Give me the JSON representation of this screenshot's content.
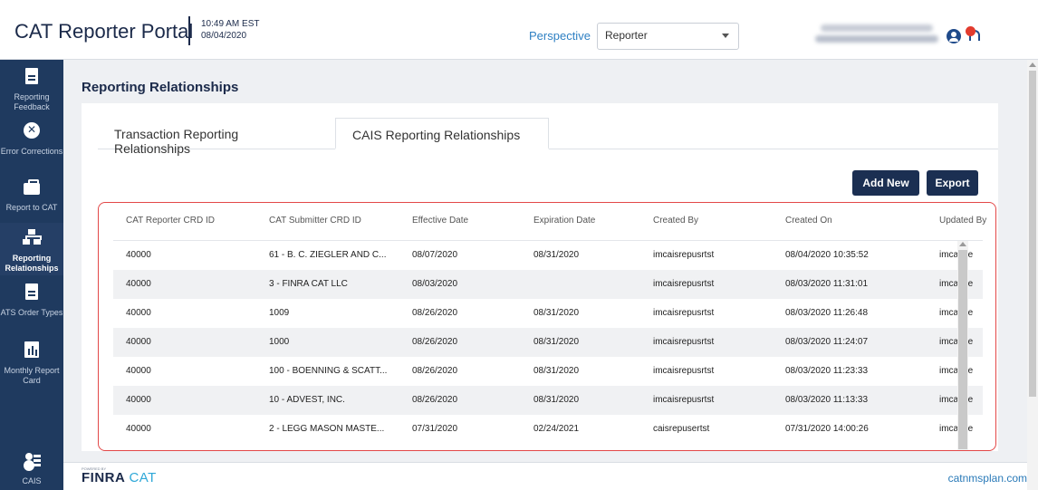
{
  "header": {
    "brand_cat": "CAT",
    "brand_rest": " Reporter Portal",
    "time": "10:49 AM EST",
    "date": "08/04/2020",
    "perspective_label": "Perspective",
    "perspective_value": "Reporter",
    "user_icon": "user-circle-icon",
    "bell_icon": "bell-icon"
  },
  "sidebar": {
    "items": [
      {
        "label": "Reporting Feedback",
        "icon": "document-icon"
      },
      {
        "label": "Error Corrections",
        "icon": "x-circle-icon"
      },
      {
        "label": "Report to CAT",
        "icon": "briefcase-icon"
      },
      {
        "label": "Reporting Relationships",
        "icon": "sitemap-icon"
      },
      {
        "label": "ATS Order Types",
        "icon": "document-icon"
      },
      {
        "label": "Monthly Report Card",
        "icon": "chart-icon"
      },
      {
        "label": "CAIS",
        "icon": "users-icon"
      }
    ]
  },
  "main": {
    "title": "Reporting Relationships",
    "tabs": [
      {
        "label": "Transaction Reporting Relationships"
      },
      {
        "label": "CAIS Reporting Relationships"
      }
    ],
    "buttons": {
      "add": "Add New",
      "export": "Export"
    }
  },
  "table": {
    "columns": [
      "CAT Reporter CRD ID",
      "CAT Submitter CRD ID",
      "Effective Date",
      "Expiration Date",
      "Created By",
      "Created On",
      "Updated By"
    ],
    "rows": [
      [
        "40000",
        "61 - B. C. ZIEGLER AND C...",
        "08/07/2020",
        "08/31/2020",
        "imcaisrepusrtst",
        "08/04/2020 10:35:52",
        "imcaisre"
      ],
      [
        "40000",
        "3 - FINRA CAT LLC",
        "08/03/2020",
        "",
        "imcaisrepusrtst",
        "08/03/2020 11:31:01",
        "imcaisre"
      ],
      [
        "40000",
        "1009",
        "08/26/2020",
        "08/31/2020",
        "imcaisrepusrtst",
        "08/03/2020 11:26:48",
        "imcaisre"
      ],
      [
        "40000",
        "1000",
        "08/26/2020",
        "08/31/2020",
        "imcaisrepusrtst",
        "08/03/2020 11:24:07",
        "imcaisre"
      ],
      [
        "40000",
        "100 - BOENNING & SCATT...",
        "08/26/2020",
        "08/31/2020",
        "imcaisrepusrtst",
        "08/03/2020 11:23:33",
        "imcaisre"
      ],
      [
        "40000",
        "10 - ADVEST, INC.",
        "08/26/2020",
        "08/31/2020",
        "imcaisrepusrtst",
        "08/03/2020 11:13:33",
        "imcaisre"
      ],
      [
        "40000",
        "2 - LEGG MASON MASTE...",
        "07/31/2020",
        "02/24/2021",
        "caisrepusertst",
        "07/31/2020 14:00:26",
        "imcaisre"
      ]
    ]
  },
  "footer": {
    "logo_small": "POWERED BY",
    "logo_finra": "FINRA",
    "logo_cat": "CAT",
    "link": "catnmsplan.com"
  },
  "colors": {
    "brand_navy": "#1b2a4a",
    "sidebar": "#1f3a5f",
    "button": "#1b2f52",
    "highlight_border": "#e34848",
    "link": "#2a7ab8"
  }
}
